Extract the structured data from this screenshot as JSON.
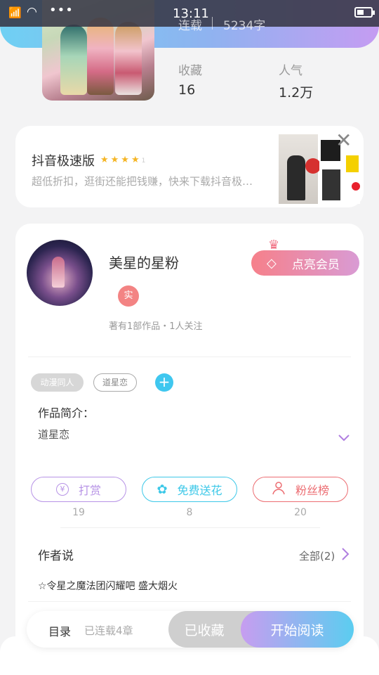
{
  "status_bar": {
    "time": "13:11"
  },
  "book": {
    "status": "连载",
    "word_count": "5234字",
    "favorites_label": "收藏",
    "favorites_value": "16",
    "popularity_label": "人气",
    "popularity_value": "1.2万"
  },
  "ad": {
    "title": "抖音极速版",
    "rating_digit": "1",
    "description": "超低折扣，逛街还能把钱赚，快来下载抖音极…"
  },
  "author": {
    "name": "美星的星粉",
    "verified_badge": "实",
    "works_info": "著有1部作品・1人关注",
    "vip_button": "点亮会员"
  },
  "tags": [
    "动漫同人",
    "道星恋"
  ],
  "intro": {
    "label": "作品简介：",
    "text": "道星恋"
  },
  "actions": [
    {
      "label": "打赏",
      "icon": "¥",
      "count": "19",
      "color": "#b793e6"
    },
    {
      "label": "免费送花",
      "icon": "✿",
      "count": "8",
      "color": "#3dc8e8"
    },
    {
      "label": "粉丝榜",
      "icon": "👤",
      "count": "20",
      "color": "#ec6d72"
    }
  ],
  "author_says": {
    "label": "作者说",
    "all_label": "全部(2)",
    "text": "☆令星之魔法团闪耀吧 盛大烟火"
  },
  "bottom_bar": {
    "toc": "目录",
    "toc_status": "已连载4章",
    "favorited": "已收藏",
    "start_reading": "开始阅读"
  }
}
